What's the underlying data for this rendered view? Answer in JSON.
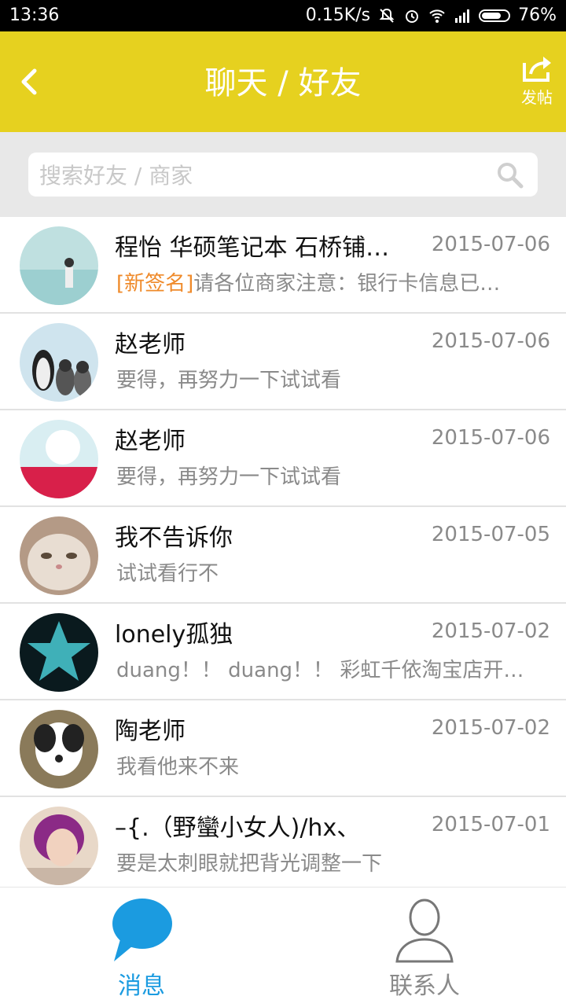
{
  "status_bar": {
    "time": "13:36",
    "speed": "0.15K/s",
    "battery": "76%",
    "battery_level": 0.76
  },
  "header": {
    "title": "聊天 / 好友",
    "back_icon": "chevron-left-icon",
    "post_label": "发帖",
    "post_icon": "share-icon",
    "color": "#e6d11f"
  },
  "search": {
    "placeholder": "搜索好友 / 商家",
    "icon": "search-icon"
  },
  "conversations": [
    {
      "name": "程怡 华硕笔记本 石桥铺…",
      "date": "2015-07-06",
      "tag": "[新签名]",
      "message": "请各位商家注意：银行卡信息已…"
    },
    {
      "name": "赵老师",
      "date": "2015-07-06",
      "tag": "",
      "message": "要得，再努力一下试试看"
    },
    {
      "name": "赵老师",
      "date": "2015-07-06",
      "tag": "",
      "message": "要得，再努力一下试试看"
    },
    {
      "name": "我不告诉你",
      "date": "2015-07-05",
      "tag": "",
      "message": "试试看行不"
    },
    {
      "name": "lonely孤独",
      "date": "2015-07-02",
      "tag": "",
      "message": "duang！！ duang！！ 彩虹千依淘宝店开…"
    },
    {
      "name": "陶老师",
      "date": "2015-07-02",
      "tag": "",
      "message": "我看他来不来"
    },
    {
      "name": "–{.（野蠻小女人)/hx、",
      "date": "2015-07-01",
      "tag": "",
      "message": "要是太刺眼就把背光调整一下"
    }
  ],
  "tabs": [
    {
      "label": "消息",
      "icon": "chat-bubble-icon",
      "active": true
    },
    {
      "label": "联系人",
      "icon": "person-icon",
      "active": false
    }
  ],
  "colors": {
    "accent_blue": "#1b9be0",
    "tag_orange": "#ef8a2a"
  }
}
